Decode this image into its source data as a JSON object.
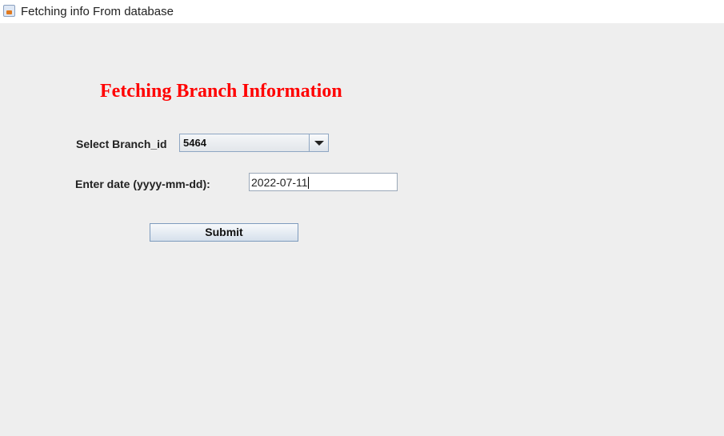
{
  "window": {
    "title": "Fetching info From database",
    "icon": "java-icon"
  },
  "form": {
    "heading": "Fetching Branch Information",
    "branch_label": "Select Branch_id",
    "branch_value": "5464",
    "date_label": "Enter date (yyyy-mm-dd):",
    "date_value": "2022-07-11",
    "submit_label": "Submit"
  },
  "colors": {
    "heading": "#ff0000",
    "background": "#eeeeee"
  }
}
